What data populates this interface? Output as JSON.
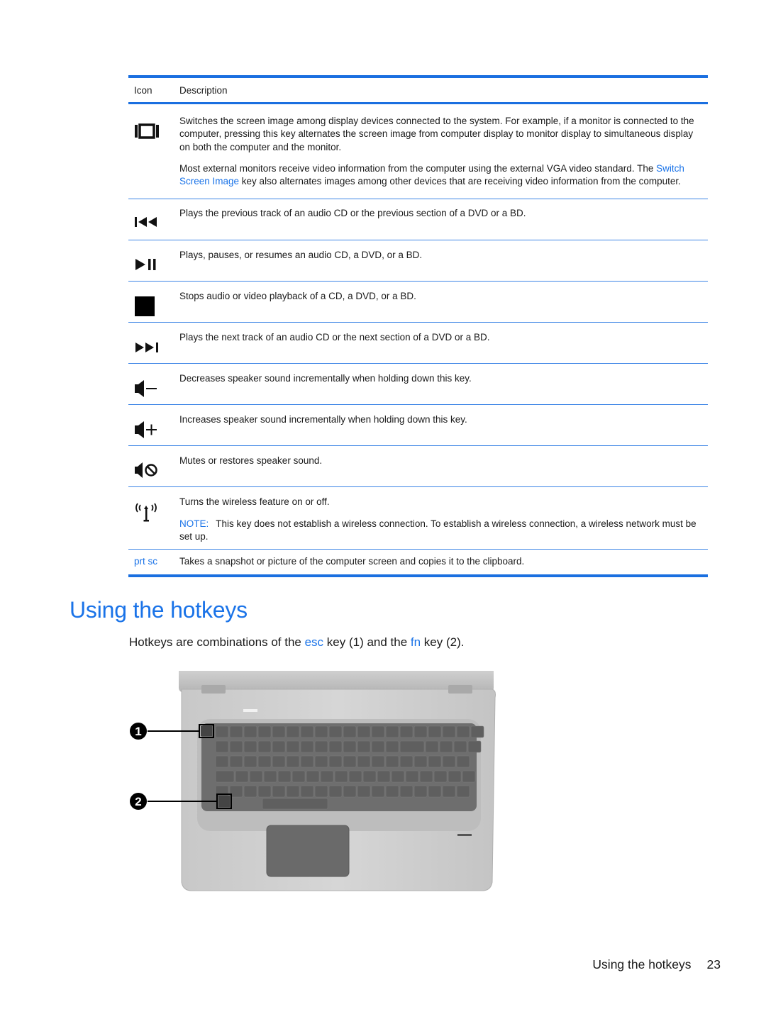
{
  "table": {
    "headers": {
      "icon": "Icon",
      "description": "Description"
    },
    "rows": [
      {
        "icon": "switch-screen-icon",
        "paragraphs": [
          {
            "segments": [
              {
                "text": "Switches the screen image among display devices connected to the system. For example, if a monitor is connected to the computer, pressing this key alternates the screen image from computer display to monitor display to simultaneous display on both the computer and the monitor."
              }
            ]
          },
          {
            "segments": [
              {
                "text": "Most external monitors receive video information from the computer using the external VGA video standard. The "
              },
              {
                "text": "Switch Screen Image",
                "link": true
              },
              {
                "text": " key also alternates images among other devices that are receiving video information from the computer."
              }
            ]
          }
        ]
      },
      {
        "icon": "previous-track-icon",
        "paragraphs": [
          {
            "segments": [
              {
                "text": "Plays the previous track of an audio CD or the previous section of a DVD or a BD."
              }
            ]
          }
        ]
      },
      {
        "icon": "play-pause-icon",
        "paragraphs": [
          {
            "segments": [
              {
                "text": "Plays, pauses, or resumes an audio CD, a DVD, or a BD."
              }
            ]
          }
        ]
      },
      {
        "icon": "stop-icon",
        "paragraphs": [
          {
            "segments": [
              {
                "text": "Stops audio or video playback of a CD, a DVD, or a BD."
              }
            ]
          }
        ]
      },
      {
        "icon": "next-track-icon",
        "paragraphs": [
          {
            "segments": [
              {
                "text": "Plays the next track of an audio CD or the next section of a DVD or a BD."
              }
            ]
          }
        ]
      },
      {
        "icon": "volume-down-icon",
        "paragraphs": [
          {
            "segments": [
              {
                "text": "Decreases speaker sound incrementally when holding down this key."
              }
            ]
          }
        ]
      },
      {
        "icon": "volume-up-icon",
        "paragraphs": [
          {
            "segments": [
              {
                "text": "Increases speaker sound incrementally when holding down this key."
              }
            ]
          }
        ]
      },
      {
        "icon": "mute-icon",
        "paragraphs": [
          {
            "segments": [
              {
                "text": "Mutes or restores speaker sound."
              }
            ]
          }
        ]
      },
      {
        "icon": "wireless-icon",
        "paragraphs": [
          {
            "segments": [
              {
                "text": "Turns the wireless feature on or off."
              }
            ]
          },
          {
            "segments": [
              {
                "text": "NOTE:",
                "note": true
              },
              {
                "text": "This key does not establish a wireless connection. To establish a wireless connection, a wireless network must be set up."
              }
            ]
          }
        ]
      },
      {
        "icon": "prt-sc-key",
        "icon_text": "prt sc",
        "paragraphs": [
          {
            "segments": [
              {
                "text": "Takes a snapshot or picture of the computer screen and copies it to the clipboard."
              }
            ]
          }
        ]
      }
    ]
  },
  "section": {
    "title": "Using the hotkeys",
    "intro": [
      {
        "text": "Hotkeys are combinations of the "
      },
      {
        "text": "esc",
        "link": true
      },
      {
        "text": " key (1) and the "
      },
      {
        "text": "fn",
        "link": true
      },
      {
        "text": " key (2)."
      }
    ]
  },
  "figure": {
    "callouts": [
      "1",
      "2"
    ],
    "callout_targets": [
      "esc key",
      "fn key"
    ]
  },
  "footer": {
    "section": "Using the hotkeys",
    "page": "23"
  },
  "colors": {
    "accent": "#1a73e8",
    "rule": "#1a6fe0",
    "text": "#1a1a1a"
  }
}
